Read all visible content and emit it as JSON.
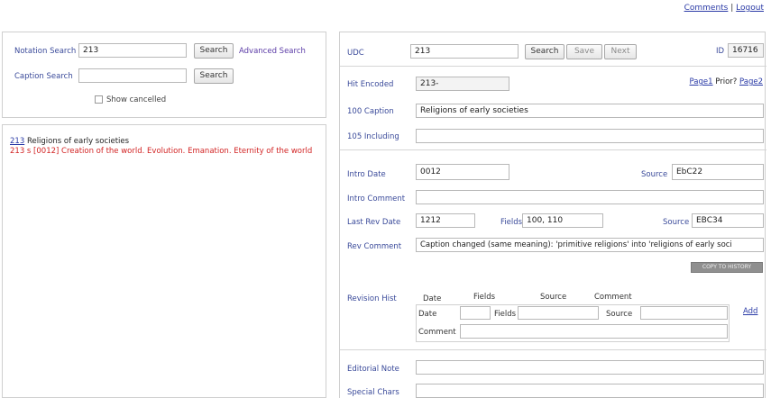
{
  "topnav": {
    "comments": "Comments",
    "sep": "|",
    "logout": "Logout"
  },
  "left": {
    "notation_label": "Notation Search",
    "notation_value": "213",
    "search_btn": "Search",
    "advanced_search": "Advanced Search",
    "caption_label": "Caption Search",
    "caption_value": "",
    "caption_search_btn": "Search",
    "show_cancelled": "Show cancelled",
    "results": [
      {
        "code": "213",
        "text": "Religions of early societies"
      },
      {
        "text": "213 s [0012] Creation of the world. Evolution. Emanation. Eternity of the world"
      }
    ]
  },
  "right": {
    "udc_label": "UDC",
    "udc_value": "213",
    "search_btn": "Search",
    "save_btn": "Save",
    "next_btn": "Next",
    "id_label": "ID",
    "id_value": "16716",
    "hit_encoded_label": "Hit Encoded",
    "hit_encoded_value": "213-",
    "page_links": {
      "page1": "Page1",
      "prior": "Prior?",
      "page2": "Page2"
    },
    "caption_label": "100 Caption",
    "caption_value": "Religions of early societies",
    "including_label": "105 Including",
    "including_value": "",
    "intro_date_label": "Intro Date",
    "intro_date_value": "0012",
    "source_label": "Source",
    "source_value": "EbC22",
    "intro_comment_label": "Intro Comment",
    "intro_comment_value": "",
    "last_rev_label": "Last Rev Date",
    "last_rev_value": "1212",
    "fields_label": "Fields",
    "fields_value": "100, 110",
    "source2_label": "Source",
    "source2_value": "EBC34",
    "rev_comment_label": "Rev Comment",
    "rev_comment_value": "Caption changed (same meaning): 'primitive religions' into 'religions of early soci",
    "copy_btn": "COPY TO HISTORY",
    "revision_label": "Revision Hist",
    "rev_headers": {
      "date": "Date",
      "fields": "Fields",
      "source": "Source",
      "comment": "Comment"
    },
    "rev_row_labels": {
      "date": "Date",
      "fields": "Fields",
      "source": "Source",
      "comment": "Comment"
    },
    "add_link": "Add",
    "editorial_label": "Editorial Note",
    "special_chars_label": "Special Chars"
  }
}
